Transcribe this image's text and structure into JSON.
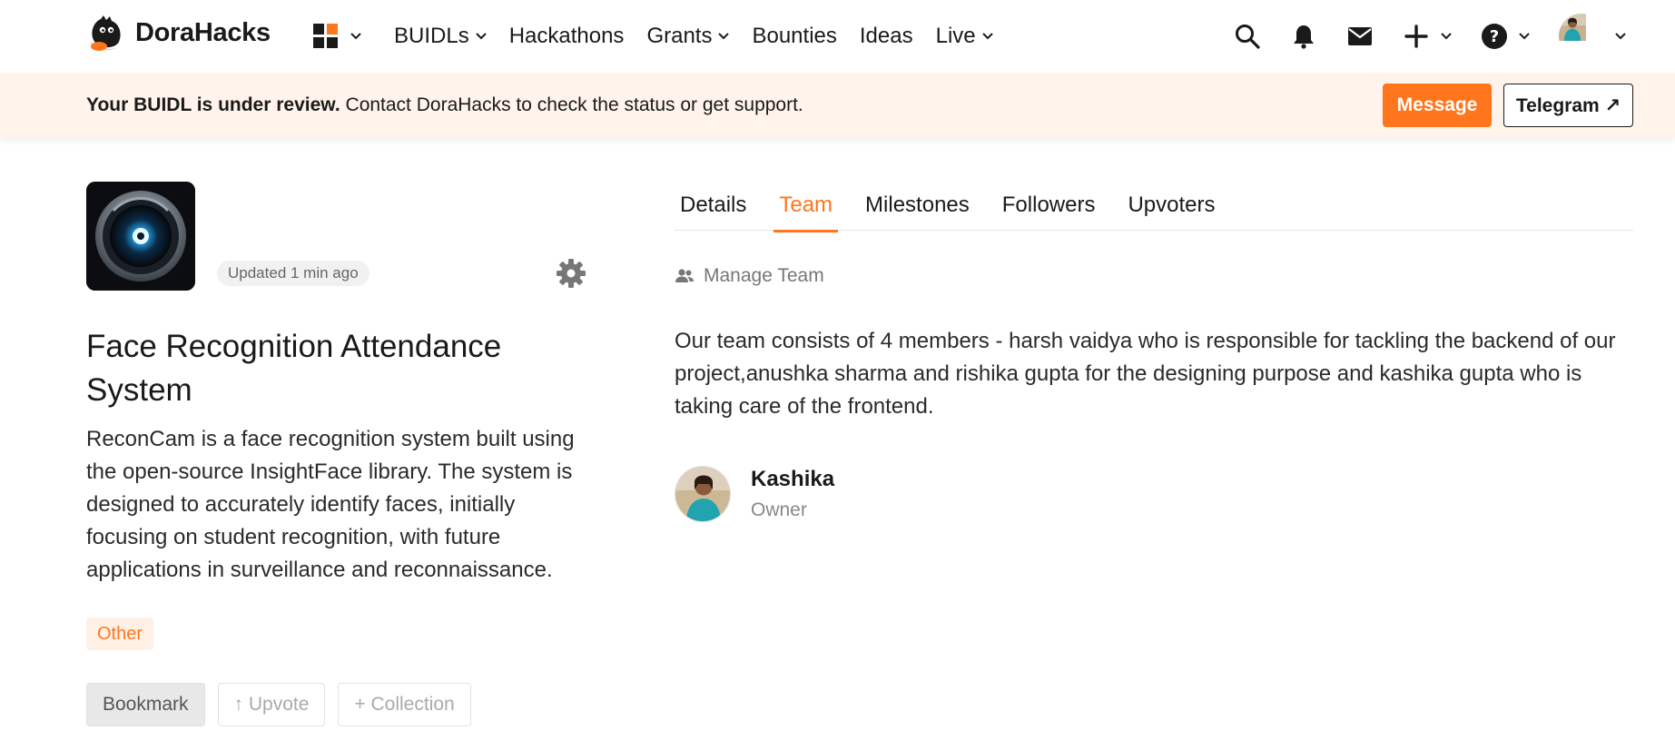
{
  "brand": {
    "name": "DoraHacks",
    "accent": "#ff761c"
  },
  "nav": {
    "items": [
      {
        "label": "BUIDLs",
        "has_dropdown": true
      },
      {
        "label": "Hackathons",
        "has_dropdown": false
      },
      {
        "label": "Grants",
        "has_dropdown": true
      },
      {
        "label": "Bounties",
        "has_dropdown": false
      },
      {
        "label": "Ideas",
        "has_dropdown": false
      },
      {
        "label": "Live",
        "has_dropdown": true
      }
    ],
    "right_icons": [
      "search-icon",
      "bell-icon",
      "mail-icon",
      "plus-icon",
      "help-icon",
      "user-avatar"
    ]
  },
  "banner": {
    "bold_text": "Your BUIDL is under review.",
    "text": " Contact DoraHacks to check the status or get support.",
    "message_label": "Message",
    "telegram_label": "Telegram ↗"
  },
  "project": {
    "updated": "Updated 1 min ago",
    "title": "Face Recognition Attendance System",
    "description": "ReconCam is a face recognition system built using the open-source InsightFace library. The system is designed to accurately identify faces, initially focusing on student recognition, with future applications in surveillance and reconnaissance.",
    "tag": "Other",
    "actions": {
      "bookmark": "Bookmark",
      "upvote": "↑ Upvote",
      "collection": "+ Collection"
    }
  },
  "tabs": [
    {
      "label": "Details",
      "active": false
    },
    {
      "label": "Team",
      "active": true
    },
    {
      "label": "Milestones",
      "active": false
    },
    {
      "label": "Followers",
      "active": false
    },
    {
      "label": "Upvoters",
      "active": false
    }
  ],
  "team": {
    "manage_label": "Manage Team",
    "description": "Our team consists of 4 members - harsh vaidya who is responsible for tackling the backend of our project,anushka sharma and rishika gupta for the designing purpose and kashika gupta who is taking care of the frontend.",
    "members": [
      {
        "name": "Kashika",
        "role": "Owner"
      }
    ]
  }
}
